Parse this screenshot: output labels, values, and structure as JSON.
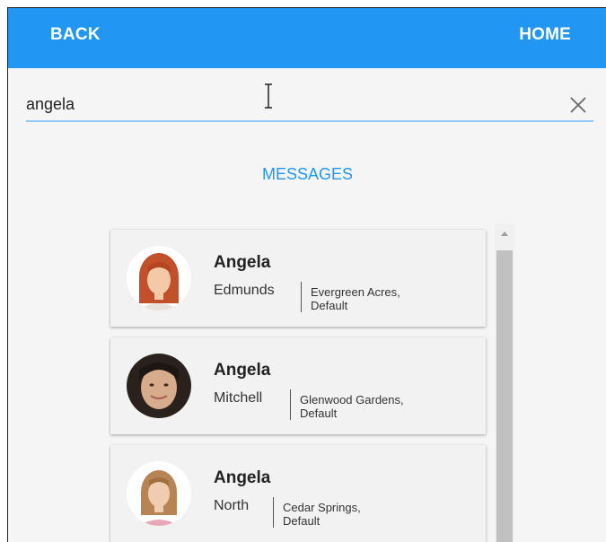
{
  "header": {
    "back_label": "BACK",
    "home_label": "HOME",
    "color": "#2196f3"
  },
  "search": {
    "value": "angela",
    "clear_icon": "close-icon"
  },
  "messages_label": "MESSAGES",
  "contacts": [
    {
      "first": "Angela",
      "last": "Edmunds",
      "location": "Evergreen Acres,",
      "group": "Default"
    },
    {
      "first": "Angela",
      "last": "Mitchell",
      "location": "Glenwood Gardens,",
      "group": "Default"
    },
    {
      "first": "Angela",
      "last": "North",
      "location": "Cedar Springs,",
      "group": "Default"
    }
  ]
}
